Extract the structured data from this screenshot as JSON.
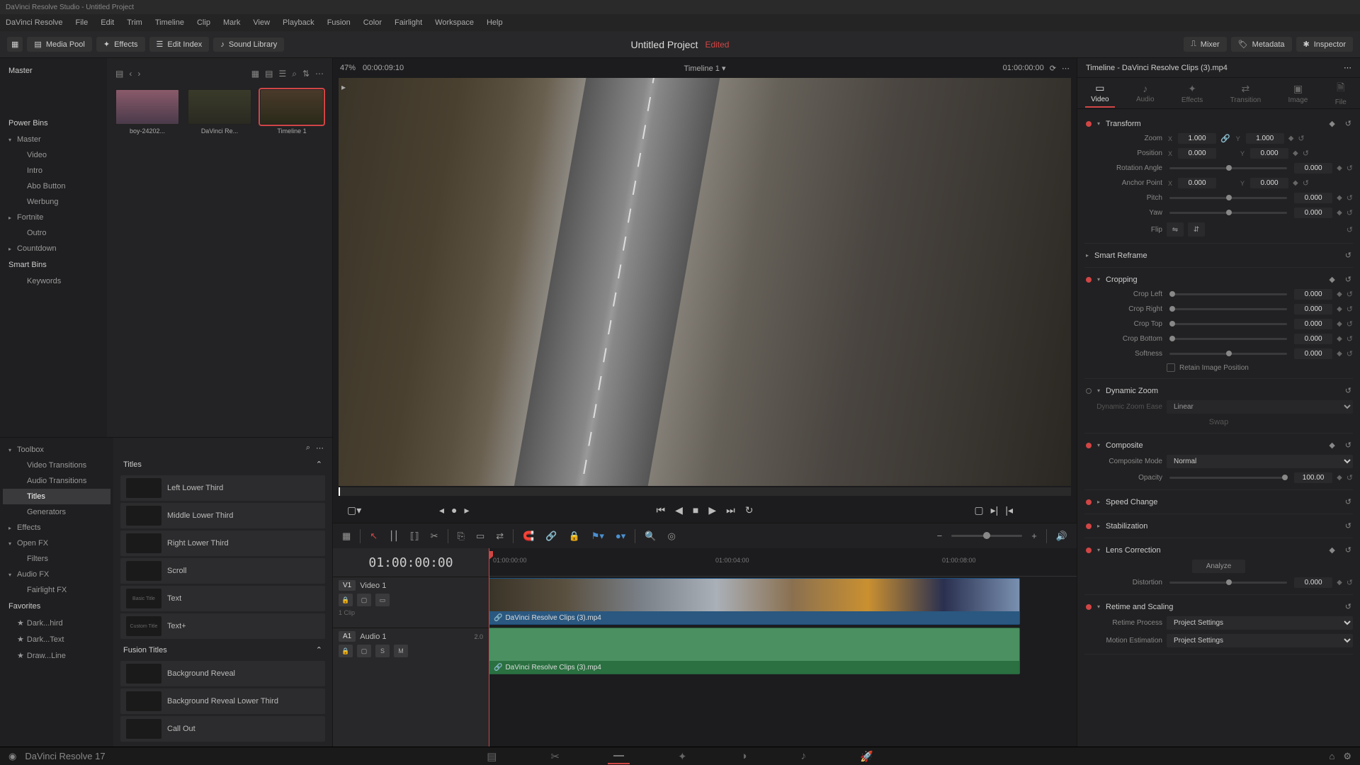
{
  "window": {
    "title": "DaVinci Resolve Studio - Untitled Project"
  },
  "menu": [
    "DaVinci Resolve",
    "File",
    "Edit",
    "Trim",
    "Timeline",
    "Clip",
    "Mark",
    "View",
    "Playback",
    "Fusion",
    "Color",
    "Fairlight",
    "Workspace",
    "Help"
  ],
  "toolbar": {
    "mediaPool": "Media Pool",
    "effects": "Effects",
    "editIndex": "Edit Index",
    "soundLib": "Sound Library",
    "project": "Untitled Project",
    "edited": "Edited",
    "mixer": "Mixer",
    "metadata": "Metadata",
    "inspector": "Inspector"
  },
  "bins": {
    "master": "Master",
    "power": "Power Bins",
    "powerItems": [
      "Master",
      "Video",
      "Intro",
      "Abo Button",
      "Werbung",
      "Fortnite",
      "Outro",
      "Countdown"
    ],
    "smart": "Smart Bins",
    "smartItems": [
      "Keywords"
    ],
    "favorites": "Favorites",
    "favItems": [
      "Dark...hird",
      "Dark...Text",
      "Draw...Line"
    ]
  },
  "clips": [
    {
      "name": "boy-24202..."
    },
    {
      "name": "DaVinci Re..."
    },
    {
      "name": "Timeline 1"
    }
  ],
  "fx": {
    "toolbox": "Toolbox",
    "toolboxItems": [
      "Video Transitions",
      "Audio Transitions",
      "Titles",
      "Generators"
    ],
    "effects": "Effects",
    "openfx": "Open FX",
    "filters": "Filters",
    "audiofx": "Audio FX",
    "fairlight": "Fairlight FX",
    "titlesHead": "Titles",
    "titles": [
      "Left Lower Third",
      "Middle Lower Third",
      "Right Lower Third",
      "Scroll",
      "Text",
      "Text+"
    ],
    "fusionHead": "Fusion Titles",
    "fusion": [
      "Background Reveal",
      "Background Reveal Lower Third",
      "Call Out"
    ]
  },
  "viewer": {
    "zoom": "47%",
    "tcIn": "00:00:09:10",
    "title": "Timeline 1",
    "tcOut": "01:00:00:00"
  },
  "timeline": {
    "tc": "01:00:00:00",
    "ticks": [
      "01:00:00:00",
      "01:00:04:00",
      "01:00:08:00"
    ],
    "v1": {
      "tag": "V1",
      "name": "Video 1",
      "info": "1 Clip"
    },
    "a1": {
      "tag": "A1",
      "name": "Audio 1",
      "ch": "2.0"
    },
    "clipName": "DaVinci Resolve Clips (3).mp4"
  },
  "inspector": {
    "title": "Timeline - DaVinci Resolve Clips (3).mp4",
    "tabs": [
      "Video",
      "Audio",
      "Effects",
      "Transition",
      "Image",
      "File"
    ],
    "transform": {
      "head": "Transform",
      "zoom": "Zoom",
      "zx": "1.000",
      "zy": "1.000",
      "pos": "Position",
      "px": "0.000",
      "py": "0.000",
      "rot": "Rotation Angle",
      "rv": "0.000",
      "anchor": "Anchor Point",
      "ax": "0.000",
      "ay": "0.000",
      "pitch": "Pitch",
      "pv": "0.000",
      "yaw": "Yaw",
      "yv": "0.000",
      "flip": "Flip"
    },
    "smartReframe": "Smart Reframe",
    "cropping": {
      "head": "Cropping",
      "left": "Crop Left",
      "lv": "0.000",
      "right": "Crop Right",
      "rv": "0.000",
      "top": "Crop Top",
      "tv": "0.000",
      "bottom": "Crop Bottom",
      "bv": "0.000",
      "soft": "Softness",
      "sv": "0.000",
      "retain": "Retain Image Position"
    },
    "dynZoom": {
      "head": "Dynamic Zoom",
      "ease": "Dynamic Zoom Ease",
      "easeVal": "Linear",
      "swap": "Swap"
    },
    "composite": {
      "head": "Composite",
      "mode": "Composite Mode",
      "modeVal": "Normal",
      "opacity": "Opacity",
      "ov": "100.00"
    },
    "speed": "Speed Change",
    "stab": "Stabilization",
    "lens": {
      "head": "Lens Correction",
      "analyze": "Analyze",
      "dist": "Distortion",
      "dv": "0.000"
    },
    "retime": {
      "head": "Retime and Scaling",
      "proc": "Retime Process",
      "procVal": "Project Settings",
      "motion": "Motion Estimation",
      "motionVal": "Project Settings"
    }
  },
  "footer": {
    "version": "DaVinci Resolve 17"
  }
}
